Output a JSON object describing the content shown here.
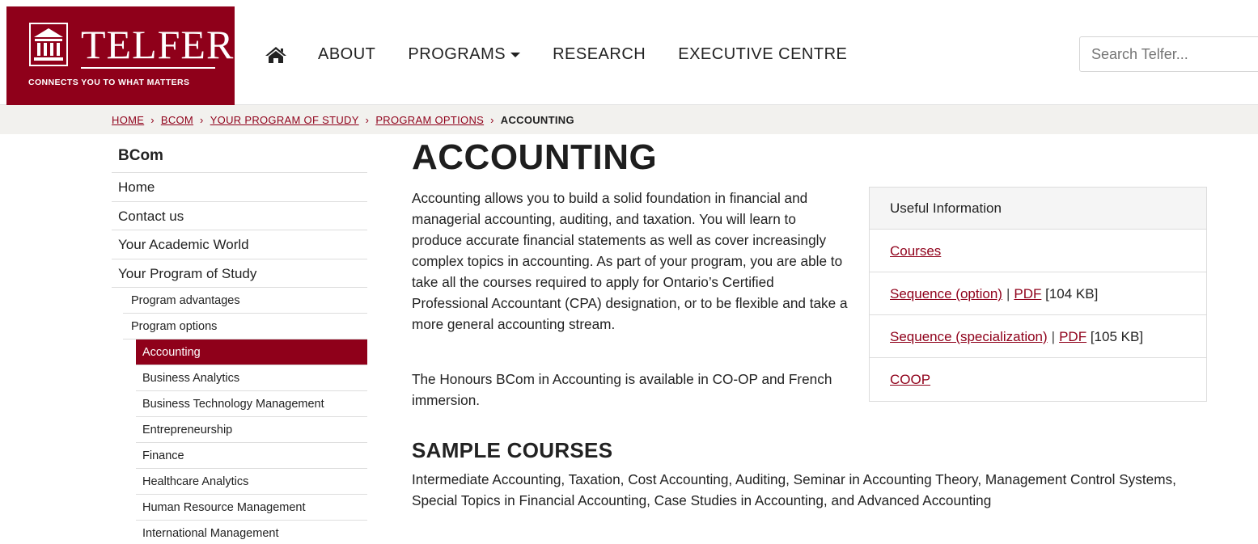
{
  "brand": {
    "wordmark": "TELFER",
    "tagline": "CONNECTS YOU TO WHAT MATTERS",
    "color": "#8f001a"
  },
  "nav": {
    "home_icon": "home-icon",
    "items": [
      "ABOUT",
      "PROGRAMS",
      "RESEARCH",
      "EXECUTIVE CENTRE"
    ]
  },
  "search": {
    "placeholder": "Search Telfer..."
  },
  "breadcrumb": {
    "links": [
      "HOME",
      "BCOM",
      "YOUR PROGRAM OF STUDY",
      "PROGRAM OPTIONS"
    ],
    "current": "ACCOUNTING",
    "separator": "›"
  },
  "sidebar": {
    "title": "BCom",
    "items": [
      "Home",
      "Contact us",
      "Your Academic World",
      "Your Program of Study"
    ],
    "sub_items": [
      "Program advantages",
      "Program options"
    ],
    "options": [
      "Accounting",
      "Business Analytics",
      "Business Technology Management",
      "Entrepreneurship",
      "Finance",
      "Healthcare Analytics",
      "Human Resource Management",
      "International Management"
    ]
  },
  "main": {
    "title": "ACCOUNTING",
    "intro": "Accounting allows you to build a solid foundation in financial and managerial accounting, auditing, and taxation. You will learn to produce accurate financial statements as well as cover increasingly complex topics in accounting. As part of your program, you are able to take all the courses required to apply for Ontario’s Certified Professional Accountant (CPA) designation, or to be flexible and take a more general accounting stream.",
    "honours": "The Honours BCom in Accounting is available in CO-OP and French immersion.",
    "sample_title": "SAMPLE COURSES",
    "sample_text": "Intermediate Accounting, Taxation, Cost Accounting, Auditing, Seminar in Accounting Theory, Management Control Systems, Special Topics in Financial Accounting, Case Studies in Accounting, and Advanced Accounting"
  },
  "info": {
    "heading": "Useful Information",
    "courses": "Courses",
    "seq_option": "Sequence (option)",
    "seq_option_pdf": "PDF",
    "seq_option_size": "[104 KB]",
    "seq_spec": "Sequence (specialization)",
    "seq_spec_pdf": "PDF",
    "seq_spec_size": "[105 KB]",
    "coop": "COOP",
    "separator": "|"
  }
}
